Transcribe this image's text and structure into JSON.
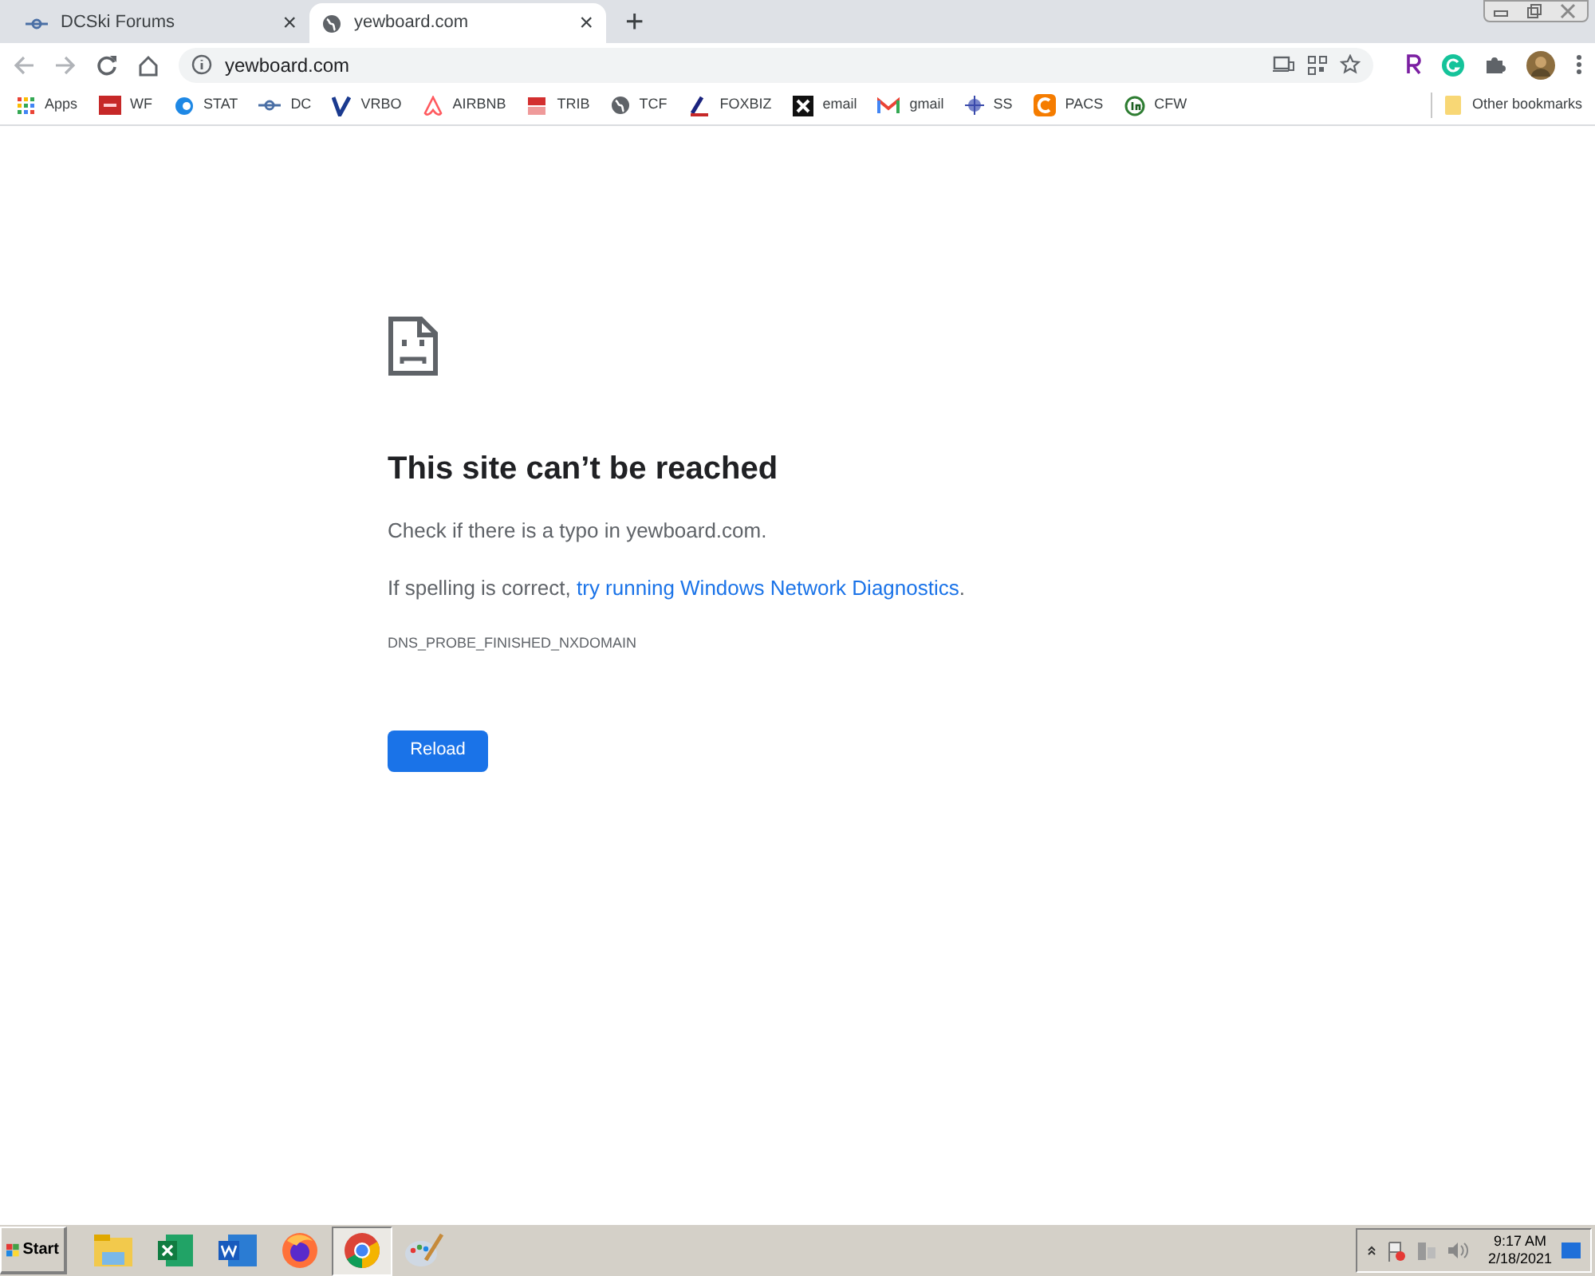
{
  "tabs": [
    {
      "title": "DCSki Forums",
      "selected": false,
      "close": "×"
    },
    {
      "title": "yewboard.com",
      "selected": true,
      "close": "×"
    }
  ],
  "new_tab": "+",
  "address_bar": {
    "url": "yewboard.com"
  },
  "bookmarks": [
    {
      "label": "Apps"
    },
    {
      "label": "WF"
    },
    {
      "label": "STAT"
    },
    {
      "label": "DC"
    },
    {
      "label": "VRBO"
    },
    {
      "label": "AIRBNB"
    },
    {
      "label": "TRIB"
    },
    {
      "label": "TCF"
    },
    {
      "label": "FOXBIZ"
    },
    {
      "label": "email"
    },
    {
      "label": "gmail"
    },
    {
      "label": "SS"
    },
    {
      "label": "PACS"
    },
    {
      "label": "CFW"
    }
  ],
  "other_bookmarks": "Other bookmarks",
  "error": {
    "heading": "This site can’t be reached",
    "line1": "Check if there is a typo in yewboard.com.",
    "line2_prefix": "If spelling is correct, ",
    "line2_link": "try running Windows Network Diagnostics",
    "line2_suffix": ".",
    "code": "DNS_PROBE_FINISHED_NXDOMAIN",
    "button": "Reload"
  },
  "taskbar": {
    "start": "Start",
    "apps": [
      {
        "selected": false
      },
      {
        "selected": false
      },
      {
        "selected": false
      },
      {
        "selected": false
      },
      {
        "selected": true
      },
      {
        "selected": false
      }
    ],
    "time": "9:17 AM",
    "date": "2/18/2021"
  }
}
